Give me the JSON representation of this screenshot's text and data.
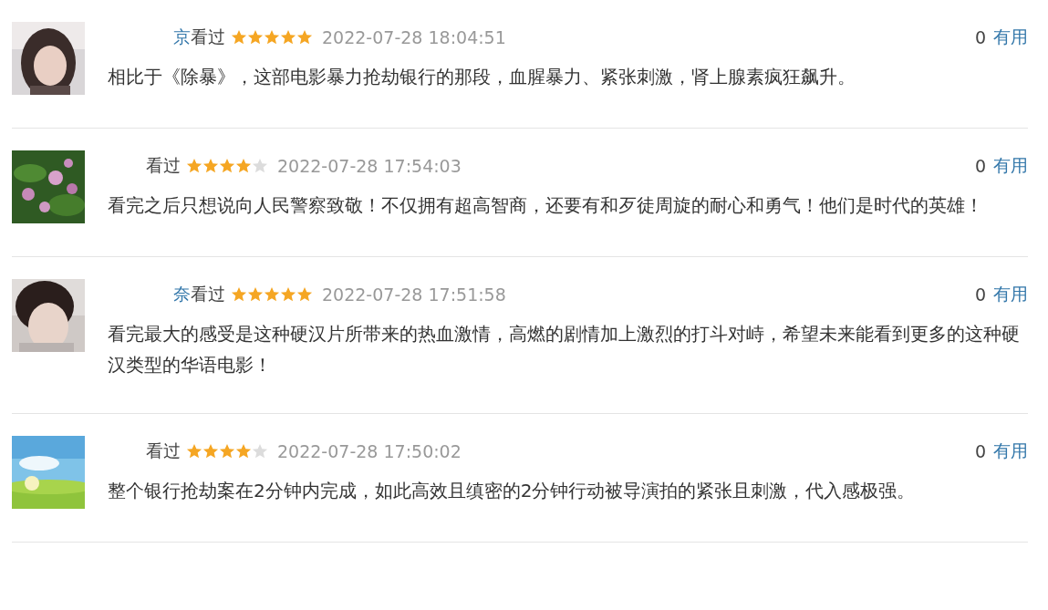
{
  "comments": [
    {
      "user": "京",
      "status": "看过",
      "stars": 5,
      "time": "2022-07-28 18:04:51",
      "votes": "0",
      "vote_label": "有用",
      "text": "相比于《除暴》，这部电影暴力抢劫银行的那段，血腥暴力、紧张刺激，肾上腺素疯狂飙升。"
    },
    {
      "status": "看过",
      "stars": 4,
      "time": "2022-07-28 17:54:03",
      "votes": "0",
      "vote_label": "有用",
      "text": "看完之后只想说向人民警察致敬！不仅拥有超高智商，还要有和歹徒周旋的耐心和勇气！他们是时代的英雄！"
    },
    {
      "user": "奈",
      "status": "看过",
      "stars": 5,
      "time": "2022-07-28 17:51:58",
      "votes": "0",
      "vote_label": "有用",
      "text": "看完最大的感受是这种硬汉片所带来的热血激情，高燃的剧情加上激烈的打斗对峙，希望未来能看到更多的这种硬汉类型的华语电影！"
    },
    {
      "status": "看过",
      "stars": 4,
      "time": "2022-07-28 17:50:02",
      "votes": "0",
      "vote_label": "有用",
      "text": "整个银行抢劫案在2分钟内完成，如此高效且缜密的2分钟行动被导演拍的紧张且刺激，代入感极强。"
    }
  ]
}
